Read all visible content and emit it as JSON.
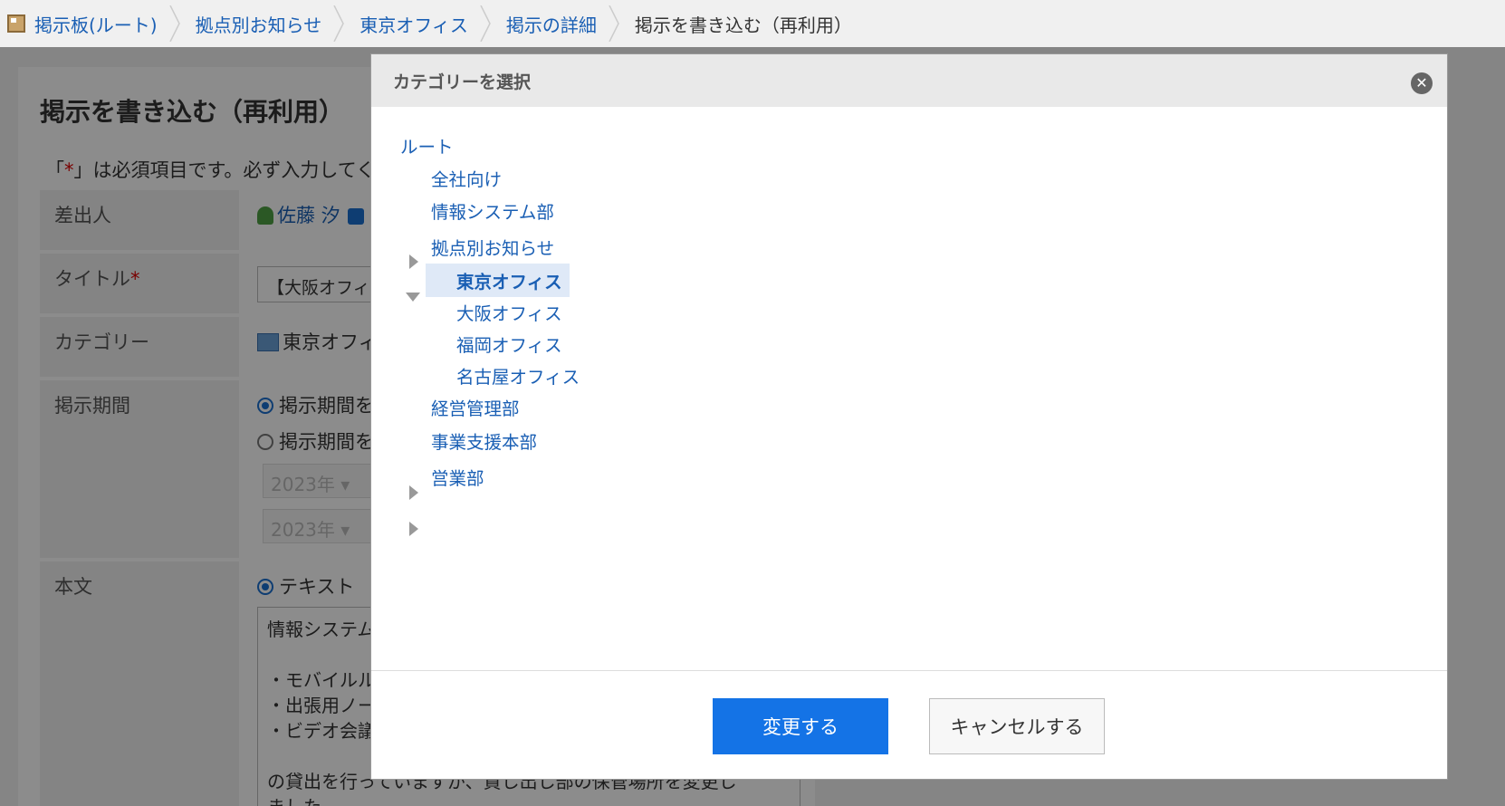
{
  "breadcrumb": [
    {
      "label": "掲示板(ルート)"
    },
    {
      "label": "拠点別お知らせ"
    },
    {
      "label": "東京オフィス"
    },
    {
      "label": "掲示の詳細"
    },
    {
      "label": "掲示を書き込む（再利用）"
    }
  ],
  "page": {
    "title": "掲示を書き込む（再利用）",
    "note_prefix": "「",
    "note_star": "*",
    "note_suffix": "」は必須項目です。必ず入力してく",
    "sender_label": "差出人",
    "sender_name": "佐藤 汐",
    "title_label": "タイトル",
    "title_star": "*",
    "title_value": "【大阪オフィス",
    "category_label": "カテゴリー",
    "category_value": "東京オフィ",
    "period_label": "掲示期間",
    "period_option1": "掲示期間を",
    "period_option2": "掲示期間を",
    "year1": "2023年",
    "year2": "2023年",
    "body_label": "本文",
    "body_mode": "テキスト",
    "body_text": "情報システム\n\n・モバイルル\n・出張用ノー\n・ビデオ会議\n\nの貸出を行っていますが、貸し出し部の保管場所を変更し\nました。"
  },
  "dialog": {
    "title": "カテゴリーを選択",
    "close_icon": "close-icon",
    "tree": [
      {
        "label": "ルート"
      },
      {
        "label": "全社向け"
      },
      {
        "label": "情報システム部"
      },
      {
        "label": "拠点別お知らせ"
      },
      {
        "label": "東京オフィス"
      },
      {
        "label": "大阪オフィス"
      },
      {
        "label": "福岡オフィス"
      },
      {
        "label": "名古屋オフィス"
      },
      {
        "label": "経営管理部"
      },
      {
        "label": "事業支援本部"
      },
      {
        "label": "営業部"
      }
    ],
    "change_button": "変更する",
    "cancel_button": "キャンセルする"
  },
  "colors": {
    "accent": "#1473e6",
    "link": "#1a5fb4",
    "selected_bg": "#dfe9f7"
  }
}
